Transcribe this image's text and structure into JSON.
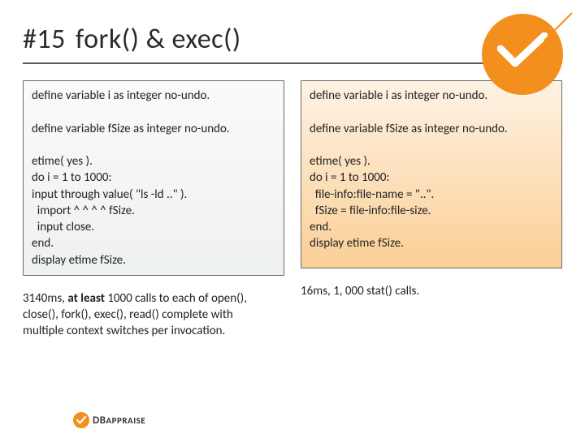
{
  "slide": {
    "number": "#15",
    "title": "fork() & exec()"
  },
  "left": {
    "code": "define variable i as integer no-undo.\n\ndefine variable fSize as integer no-undo.\n\netime( yes ).\ndo i = 1 to 1000:\ninput through value( \"ls -ld ..\" ).\n  import ^ ^ ^ ^ fSize.\n  input close.\nend.\ndisplay etime fSize.",
    "caption_pre": "3140ms, ",
    "caption_bold": "at least",
    "caption_post": " 1000 calls to each of open(), close(), fork(), exec(), read() complete with multiple context switches per invocation."
  },
  "right": {
    "code": "define variable i as integer no-undo.\n\ndefine variable fSize as integer no-undo.\n\netime( yes ).\ndo i = 1 to 1000:\n  file-info:file-name = \"..\".\n  fSize = file-info:file-size.\nend.\ndisplay etime fSize.",
    "caption": "16ms, 1, 000 stat() calls."
  },
  "branding": {
    "logo_name": "checkmark-disc-logo",
    "footer_db": "DB",
    "footer_rest": "APPRAISE"
  }
}
